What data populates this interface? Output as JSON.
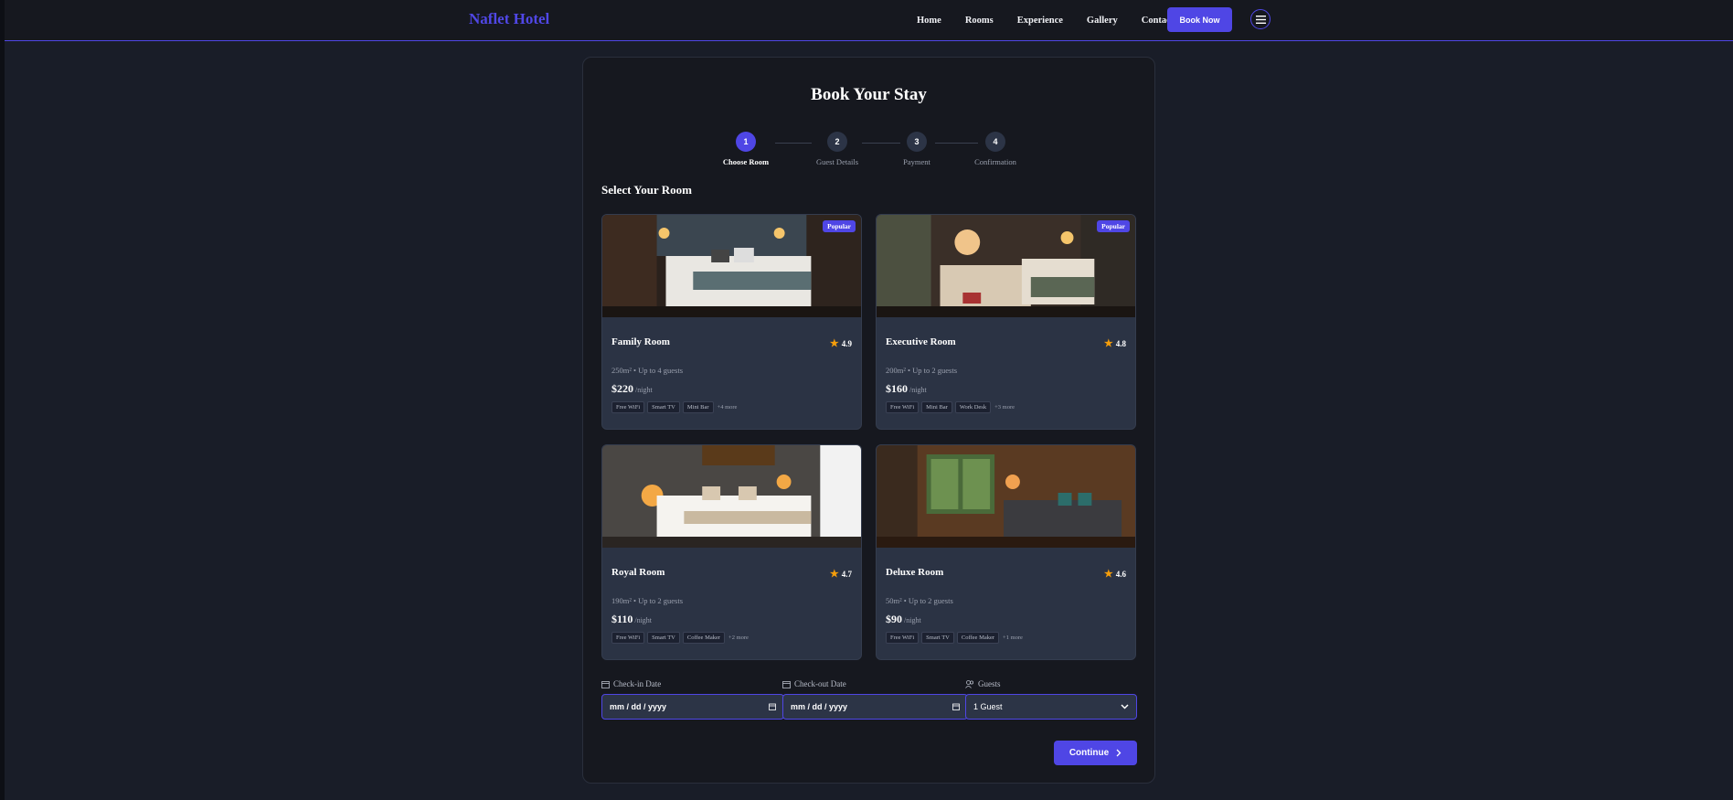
{
  "nav": {
    "brand": "Naflet Hotel",
    "links": [
      "Home",
      "Rooms",
      "Experience",
      "Gallery",
      "Contact"
    ],
    "book_now": "Book Now"
  },
  "booking": {
    "title": "Book Your Stay",
    "steps": [
      {
        "number": "1",
        "label": "Choose Room"
      },
      {
        "number": "2",
        "label": "Guest Details"
      },
      {
        "number": "3",
        "label": "Payment"
      },
      {
        "number": "4",
        "label": "Confirmation"
      }
    ],
    "active_step": 1,
    "section_title": "Select Your Room",
    "rooms": [
      {
        "name": "Family Room",
        "rating": "4.9",
        "meta": "250m² • Up to 4 guests",
        "price": "$220",
        "per": "/night",
        "badge": "Popular",
        "amenities": [
          "Free WiFi",
          "Smart TV",
          "Mini Bar"
        ],
        "more": "+4 more"
      },
      {
        "name": "Executive Room",
        "rating": "4.8",
        "meta": "200m² • Up to 2 guests",
        "price": "$160",
        "per": "/night",
        "badge": "Popular",
        "amenities": [
          "Free WiFi",
          "Mini Bar",
          "Work Desk"
        ],
        "more": "+3 more"
      },
      {
        "name": "Royal Room",
        "rating": "4.7",
        "meta": "190m² • Up to 2 guests",
        "price": "$110",
        "per": "/night",
        "badge": "",
        "amenities": [
          "Free WiFi",
          "Smart TV",
          "Coffee Maker"
        ],
        "more": "+2 more"
      },
      {
        "name": "Deluxe Room",
        "rating": "4.6",
        "meta": "50m² • Up to 2 guests",
        "price": "$90",
        "per": "/night",
        "badge": "",
        "amenities": [
          "Free WiFi",
          "Smart TV",
          "Coffee Maker"
        ],
        "more": "+1 more"
      }
    ],
    "form": {
      "checkin_label": "Check-in Date",
      "checkin_value": "mm / dd / yyyy",
      "checkout_label": "Check-out Date",
      "checkout_value": "mm / dd / yyyy",
      "guests_label": "Guests",
      "guests_value": "1 Guest"
    },
    "continue": "Continue"
  },
  "colors": {
    "accent": "#4f46e5",
    "background": "#191d28",
    "card": "#16181f",
    "room_card": "#2b3344",
    "star": "#f59e0b"
  }
}
